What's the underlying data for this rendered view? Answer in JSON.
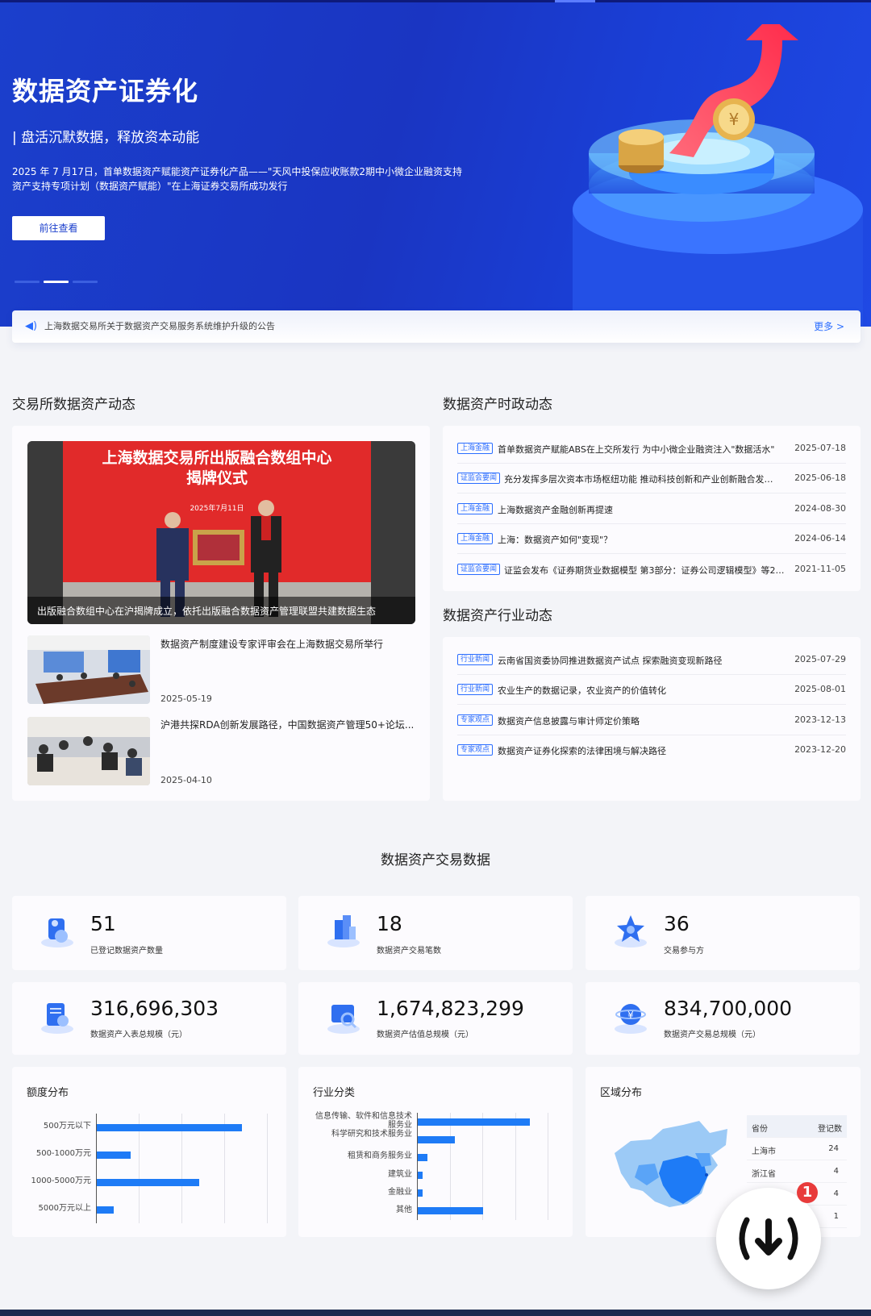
{
  "hero": {
    "title": "数据资产证券化",
    "subtitle": "| 盘活沉默数据，释放资本动能",
    "desc": "2025 年 7 月17日，首单数据资产赋能资产证券化产品——\"天风中投保应收账款2期中小微企业融资支持资产支持专项计划（数据资产赋能）\"在上海证券交易所成功发行",
    "button": "前往查看"
  },
  "notice": {
    "icon": "speaker-icon",
    "text": "上海数据交易所关于数据资产交易服务系统维护升级的公告",
    "more": "更多 >"
  },
  "exchange_news": {
    "heading": "交易所数据资产动态",
    "main_image_title": "上海数据交易所出版融合数组中心",
    "main_image_title2": "揭牌仪式",
    "main_image_date": "2025年7月11日",
    "main_caption": "出版融合数组中心在沪揭牌成立，依托出版融合数据资产管理联盟共建数据生态",
    "items": [
      {
        "title": "数据资产制度建设专家评审会在上海数据交易所举行",
        "date": "2025-05-19"
      },
      {
        "title": "沪港共探RDA创新发展路径，中国数据资产管理50+论坛...",
        "date": "2025-04-10"
      }
    ]
  },
  "policy_news": {
    "heading": "数据资产时政动态",
    "items": [
      {
        "tag": "上海金融",
        "title": "首单数据资产赋能ABS在上交所发行 为中小微企业融资注入\"数据活水\"",
        "date": "2025-07-18"
      },
      {
        "tag": "证监会要闻",
        "title": "充分发挥多层次资本市场枢纽功能 推动科技创新和产业创新融合发展一...",
        "date": "2025-06-18"
      },
      {
        "tag": "上海金融",
        "title": "上海数据资产金融创新再提速",
        "date": "2024-08-30"
      },
      {
        "tag": "上海金融",
        "title": "上海：数据资产如何\"变现\"？",
        "date": "2024-06-14"
      },
      {
        "tag": "证监会要闻",
        "title": "证监会发布《证券期货业数据模型 第3部分：证券公司逻辑模型》等2项金...",
        "date": "2021-11-05"
      }
    ]
  },
  "industry_news": {
    "heading": "数据资产行业动态",
    "items": [
      {
        "tag": "行业新闻",
        "title": "云南省国资委协同推进数据资产试点 探索融资变现新路径",
        "date": "2025-07-29"
      },
      {
        "tag": "行业新闻",
        "title": "农业生产的数据记录，农业资产的价值转化",
        "date": "2025-08-01"
      },
      {
        "tag": "专家观点",
        "title": "数据资产信息披露与审计师定价策略",
        "date": "2023-12-13"
      },
      {
        "tag": "专家观点",
        "title": "数据资产证券化探索的法律困境与解决路径",
        "date": "2023-12-20"
      }
    ]
  },
  "stats": {
    "heading": "数据资产交易数据",
    "items": [
      {
        "value": "51",
        "label": "已登记数据资产数量",
        "icon": "database-icon"
      },
      {
        "value": "18",
        "label": "数据资产交易笔数",
        "icon": "building-icon"
      },
      {
        "value": "36",
        "label": "交易参与方",
        "icon": "star-icon"
      },
      {
        "value": "316,696,303",
        "label": "数据资产入表总规模（元）",
        "icon": "document-icon"
      },
      {
        "value": "1,674,823,299",
        "label": "数据资产估值总规模（元）",
        "icon": "search-chart-icon"
      },
      {
        "value": "834,700,000",
        "label": "数据资产交易总规模（元）",
        "icon": "globe-icon"
      }
    ]
  },
  "chart_data": [
    {
      "type": "bar",
      "orientation": "horizontal",
      "title": "额度分布",
      "categories": [
        "500万元以下",
        "500-1000万元",
        "1000-5000万元",
        "5000万元以上"
      ],
      "values": [
        34,
        8,
        24,
        4
      ]
    },
    {
      "type": "bar",
      "orientation": "horizontal",
      "title": "行业分类",
      "categories": [
        "信息传输、软件和信息技术服务业",
        "科学研究和技术服务业",
        "租赁和商务服务业",
        "建筑业",
        "金融业",
        "其他"
      ],
      "values": [
        24,
        8,
        2,
        1,
        1,
        14
      ]
    },
    {
      "type": "table",
      "title": "区域分布",
      "columns": [
        "省份",
        "登记数"
      ],
      "rows": [
        [
          "上海市",
          "24"
        ],
        [
          "浙江省",
          "4"
        ],
        [
          "",
          "4"
        ],
        [
          "",
          "1"
        ]
      ]
    }
  ],
  "fab": {
    "badge": "1",
    "icon": "download-icon"
  }
}
